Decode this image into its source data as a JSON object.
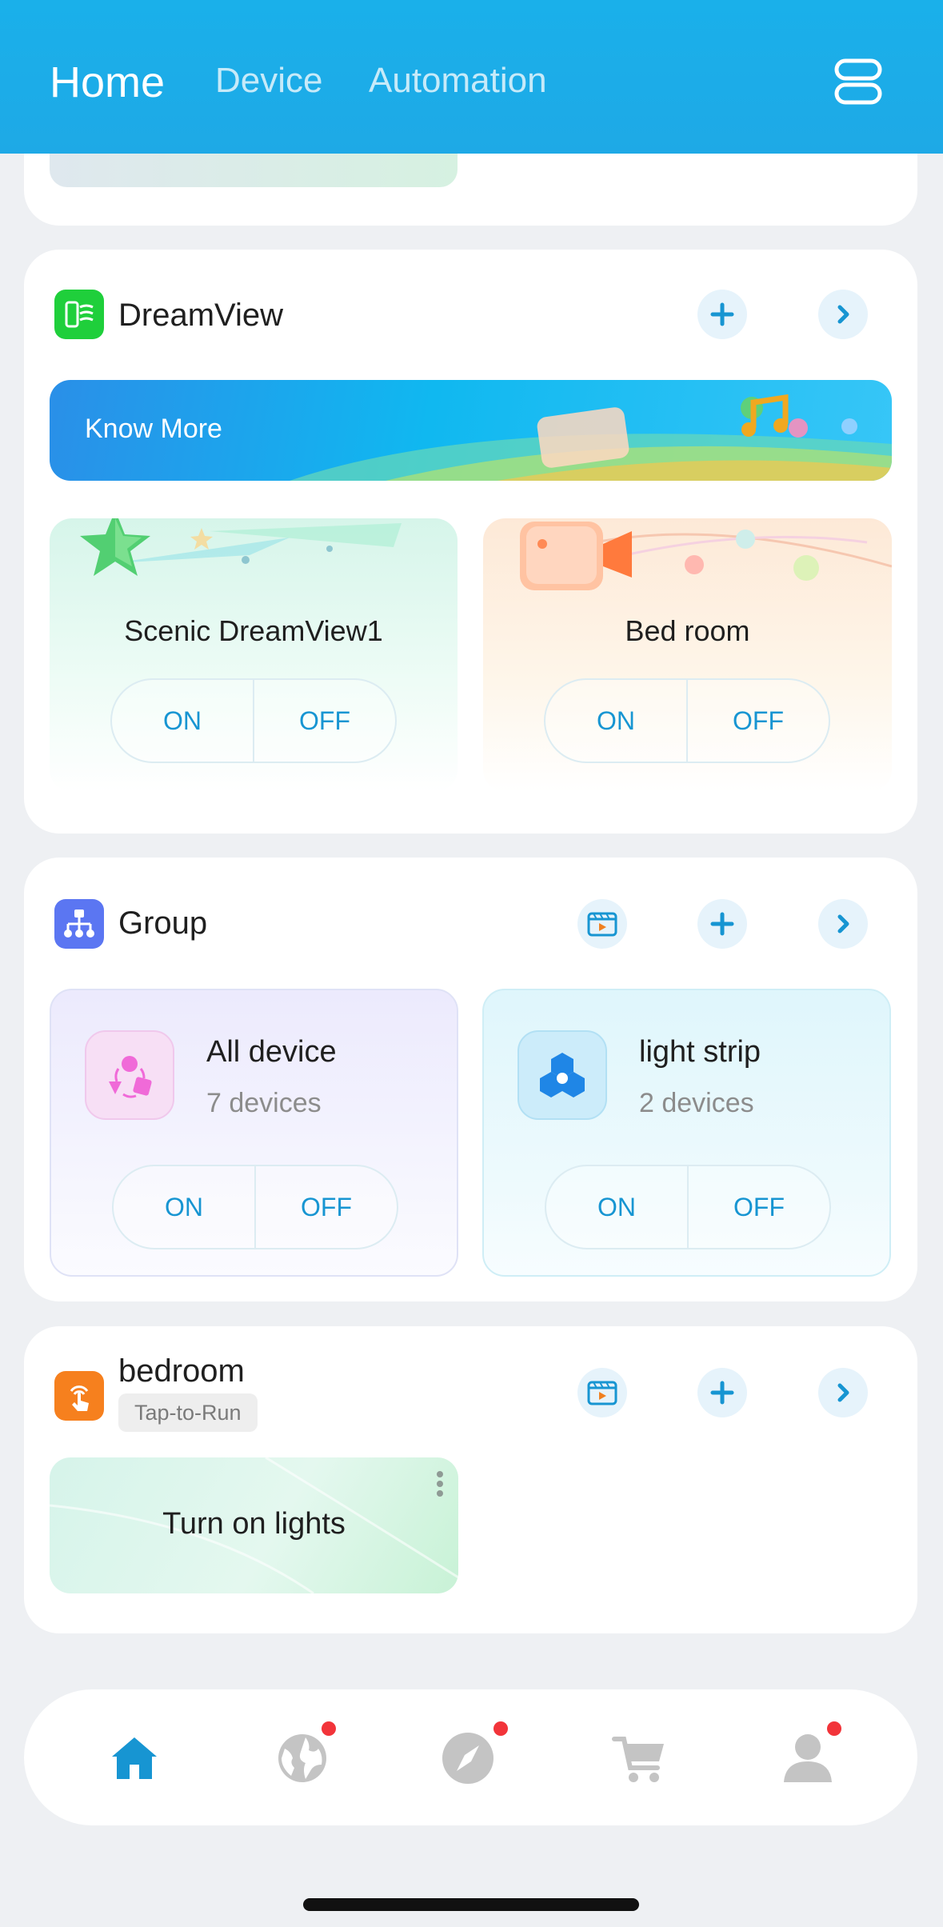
{
  "header": {
    "tabs": [
      {
        "label": "Home",
        "active": true
      },
      {
        "label": "Device",
        "active": false
      },
      {
        "label": "Automation",
        "active": false
      }
    ]
  },
  "dreamview": {
    "title": "DreamView",
    "banner": "Know More",
    "tiles": [
      {
        "name": "Scenic DreamView1",
        "on": "ON",
        "off": "OFF"
      },
      {
        "name": "Bed room",
        "on": "ON",
        "off": "OFF"
      }
    ]
  },
  "group": {
    "title": "Group",
    "tiles": [
      {
        "name": "All device",
        "count": "7 devices",
        "on": "ON",
        "off": "OFF"
      },
      {
        "name": "light strip",
        "count": "2 devices",
        "on": "ON",
        "off": "OFF"
      }
    ]
  },
  "bedroom": {
    "title": "bedroom",
    "badge": "Tap-to-Run",
    "scene": "Turn on lights"
  },
  "nav": {
    "items": [
      "home-icon",
      "globe-icon",
      "compass-icon",
      "cart-icon",
      "profile-icon"
    ],
    "accent": "#1795d2",
    "badge_color": "#f2343a"
  }
}
